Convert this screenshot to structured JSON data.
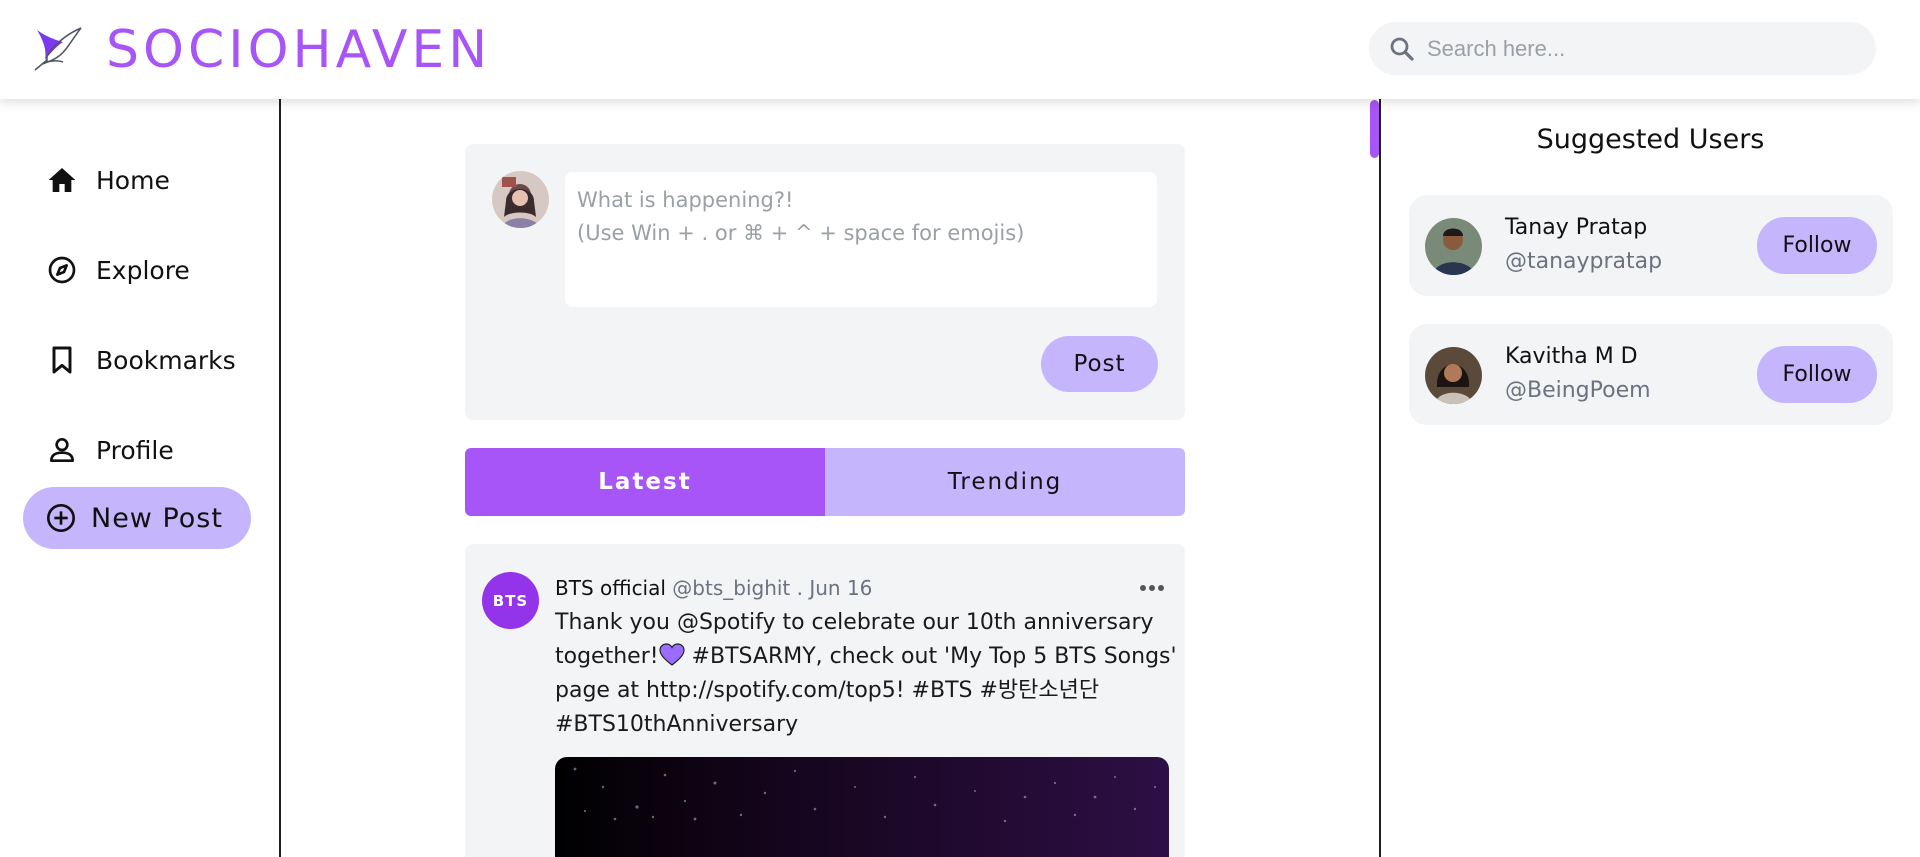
{
  "header": {
    "brand": "SOCIOHAVEN",
    "search_placeholder": "Search here...",
    "logo_icon": "bird-logo-icon",
    "search_icon": "search-icon"
  },
  "sidebar": {
    "items": [
      {
        "label": "Home",
        "icon": "home-icon"
      },
      {
        "label": "Explore",
        "icon": "compass-icon"
      },
      {
        "label": "Bookmarks",
        "icon": "bookmark-icon"
      },
      {
        "label": "Profile",
        "icon": "user-icon"
      }
    ],
    "new_post_label": "New Post",
    "new_post_icon": "plus-circle-icon"
  },
  "composer": {
    "placeholder": "What is happening?!\n(Use Win + . or ⌘ + ^ + space for emojis)",
    "post_label": "Post"
  },
  "tabs": [
    {
      "label": "Latest",
      "active": true
    },
    {
      "label": "Trending",
      "active": false
    }
  ],
  "post": {
    "avatar_text": "BTS",
    "name": "BTS official",
    "meta": "@bts_bighit . Jun 16",
    "text_part1": "Thank you @Spotify to celebrate our 10th anniversary together!",
    "text_part2": " #BTSARMY, check out 'My Top 5 BTS Songs' page at http://spotify.com/top5! #BTS #방탄소년단 #BTS10thAnniversary",
    "heart_icon": "purple-heart-icon",
    "menu_icon": "more-horizontal-icon"
  },
  "suggested": {
    "title": "Suggested Users",
    "users": [
      {
        "name": "Tanay Pratap",
        "handle": "@tanaypratap",
        "follow_label": "Follow"
      },
      {
        "name": "Kavitha M D",
        "handle": "@BeingPoem",
        "follow_label": "Follow"
      }
    ]
  },
  "colors": {
    "accent": "#a855f7",
    "accent_light": "#c4b5fd",
    "card_bg": "#f3f4f6"
  }
}
